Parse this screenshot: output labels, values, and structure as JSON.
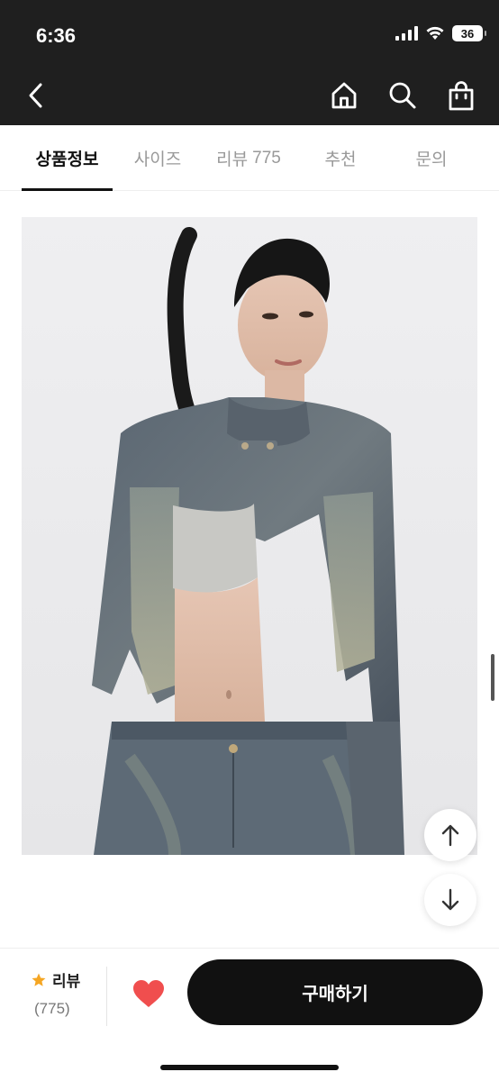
{
  "status_bar": {
    "time": "6:36",
    "battery": "36"
  },
  "nav": {
    "back_icon": "chevron-left-icon",
    "home_icon": "home-icon",
    "search_icon": "search-icon",
    "cart_icon": "shopping-bag-icon"
  },
  "tabs": [
    {
      "label": "상품정보",
      "active": true
    },
    {
      "label": "사이즈"
    },
    {
      "label": "리뷰",
      "count": "775"
    },
    {
      "label": "추천"
    },
    {
      "label": "문의"
    }
  ],
  "product_image": {
    "alt": "Model wearing cropped washed denim jacket with grey bandeau top and denim jeans"
  },
  "float_buttons": {
    "up_icon": "arrow-up-icon",
    "down_icon": "arrow-down-icon"
  },
  "bottom_bar": {
    "review_label": "리뷰",
    "review_count": "(775)",
    "buy_label": "구매하기",
    "colors": {
      "star": "#f5a623",
      "heart": "#f04e4e",
      "buy_bg": "#111111"
    }
  }
}
